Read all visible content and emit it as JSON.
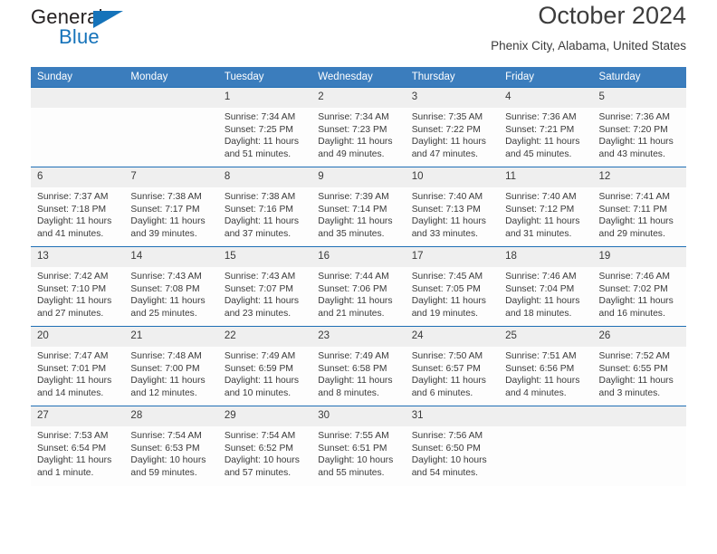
{
  "logo": {
    "word_top": "General",
    "word_bottom": "Blue",
    "triangle_color": "#1573ba",
    "text_color": "#231f20"
  },
  "header": {
    "title": "October 2024",
    "subtitle": "Phenix City, Alabama, United States"
  },
  "theme": {
    "header_row_bg": "#3b7dbd",
    "week_divider": "#1f6fb5",
    "daynum_bg": "#efefef",
    "cell_bg": "#fdfdfd"
  },
  "labels": {
    "sunrise_prefix": "Sunrise:",
    "sunset_prefix": "Sunset:",
    "daylight_prefix": "Daylight:"
  },
  "day_headers": [
    "Sunday",
    "Monday",
    "Tuesday",
    "Wednesday",
    "Thursday",
    "Friday",
    "Saturday"
  ],
  "weeks": [
    [
      {
        "day": "",
        "sunrise": "",
        "sunset": "",
        "daylight_line1": "",
        "daylight_line2": ""
      },
      {
        "day": "",
        "sunrise": "",
        "sunset": "",
        "daylight_line1": "",
        "daylight_line2": ""
      },
      {
        "day": "1",
        "sunrise": "Sunrise: 7:34 AM",
        "sunset": "Sunset: 7:25 PM",
        "daylight_line1": "Daylight: 11 hours",
        "daylight_line2": "and 51 minutes."
      },
      {
        "day": "2",
        "sunrise": "Sunrise: 7:34 AM",
        "sunset": "Sunset: 7:23 PM",
        "daylight_line1": "Daylight: 11 hours",
        "daylight_line2": "and 49 minutes."
      },
      {
        "day": "3",
        "sunrise": "Sunrise: 7:35 AM",
        "sunset": "Sunset: 7:22 PM",
        "daylight_line1": "Daylight: 11 hours",
        "daylight_line2": "and 47 minutes."
      },
      {
        "day": "4",
        "sunrise": "Sunrise: 7:36 AM",
        "sunset": "Sunset: 7:21 PM",
        "daylight_line1": "Daylight: 11 hours",
        "daylight_line2": "and 45 minutes."
      },
      {
        "day": "5",
        "sunrise": "Sunrise: 7:36 AM",
        "sunset": "Sunset: 7:20 PM",
        "daylight_line1": "Daylight: 11 hours",
        "daylight_line2": "and 43 minutes."
      }
    ],
    [
      {
        "day": "6",
        "sunrise": "Sunrise: 7:37 AM",
        "sunset": "Sunset: 7:18 PM",
        "daylight_line1": "Daylight: 11 hours",
        "daylight_line2": "and 41 minutes."
      },
      {
        "day": "7",
        "sunrise": "Sunrise: 7:38 AM",
        "sunset": "Sunset: 7:17 PM",
        "daylight_line1": "Daylight: 11 hours",
        "daylight_line2": "and 39 minutes."
      },
      {
        "day": "8",
        "sunrise": "Sunrise: 7:38 AM",
        "sunset": "Sunset: 7:16 PM",
        "daylight_line1": "Daylight: 11 hours",
        "daylight_line2": "and 37 minutes."
      },
      {
        "day": "9",
        "sunrise": "Sunrise: 7:39 AM",
        "sunset": "Sunset: 7:14 PM",
        "daylight_line1": "Daylight: 11 hours",
        "daylight_line2": "and 35 minutes."
      },
      {
        "day": "10",
        "sunrise": "Sunrise: 7:40 AM",
        "sunset": "Sunset: 7:13 PM",
        "daylight_line1": "Daylight: 11 hours",
        "daylight_line2": "and 33 minutes."
      },
      {
        "day": "11",
        "sunrise": "Sunrise: 7:40 AM",
        "sunset": "Sunset: 7:12 PM",
        "daylight_line1": "Daylight: 11 hours",
        "daylight_line2": "and 31 minutes."
      },
      {
        "day": "12",
        "sunrise": "Sunrise: 7:41 AM",
        "sunset": "Sunset: 7:11 PM",
        "daylight_line1": "Daylight: 11 hours",
        "daylight_line2": "and 29 minutes."
      }
    ],
    [
      {
        "day": "13",
        "sunrise": "Sunrise: 7:42 AM",
        "sunset": "Sunset: 7:10 PM",
        "daylight_line1": "Daylight: 11 hours",
        "daylight_line2": "and 27 minutes."
      },
      {
        "day": "14",
        "sunrise": "Sunrise: 7:43 AM",
        "sunset": "Sunset: 7:08 PM",
        "daylight_line1": "Daylight: 11 hours",
        "daylight_line2": "and 25 minutes."
      },
      {
        "day": "15",
        "sunrise": "Sunrise: 7:43 AM",
        "sunset": "Sunset: 7:07 PM",
        "daylight_line1": "Daylight: 11 hours",
        "daylight_line2": "and 23 minutes."
      },
      {
        "day": "16",
        "sunrise": "Sunrise: 7:44 AM",
        "sunset": "Sunset: 7:06 PM",
        "daylight_line1": "Daylight: 11 hours",
        "daylight_line2": "and 21 minutes."
      },
      {
        "day": "17",
        "sunrise": "Sunrise: 7:45 AM",
        "sunset": "Sunset: 7:05 PM",
        "daylight_line1": "Daylight: 11 hours",
        "daylight_line2": "and 19 minutes."
      },
      {
        "day": "18",
        "sunrise": "Sunrise: 7:46 AM",
        "sunset": "Sunset: 7:04 PM",
        "daylight_line1": "Daylight: 11 hours",
        "daylight_line2": "and 18 minutes."
      },
      {
        "day": "19",
        "sunrise": "Sunrise: 7:46 AM",
        "sunset": "Sunset: 7:02 PM",
        "daylight_line1": "Daylight: 11 hours",
        "daylight_line2": "and 16 minutes."
      }
    ],
    [
      {
        "day": "20",
        "sunrise": "Sunrise: 7:47 AM",
        "sunset": "Sunset: 7:01 PM",
        "daylight_line1": "Daylight: 11 hours",
        "daylight_line2": "and 14 minutes."
      },
      {
        "day": "21",
        "sunrise": "Sunrise: 7:48 AM",
        "sunset": "Sunset: 7:00 PM",
        "daylight_line1": "Daylight: 11 hours",
        "daylight_line2": "and 12 minutes."
      },
      {
        "day": "22",
        "sunrise": "Sunrise: 7:49 AM",
        "sunset": "Sunset: 6:59 PM",
        "daylight_line1": "Daylight: 11 hours",
        "daylight_line2": "and 10 minutes."
      },
      {
        "day": "23",
        "sunrise": "Sunrise: 7:49 AM",
        "sunset": "Sunset: 6:58 PM",
        "daylight_line1": "Daylight: 11 hours",
        "daylight_line2": "and 8 minutes."
      },
      {
        "day": "24",
        "sunrise": "Sunrise: 7:50 AM",
        "sunset": "Sunset: 6:57 PM",
        "daylight_line1": "Daylight: 11 hours",
        "daylight_line2": "and 6 minutes."
      },
      {
        "day": "25",
        "sunrise": "Sunrise: 7:51 AM",
        "sunset": "Sunset: 6:56 PM",
        "daylight_line1": "Daylight: 11 hours",
        "daylight_line2": "and 4 minutes."
      },
      {
        "day": "26",
        "sunrise": "Sunrise: 7:52 AM",
        "sunset": "Sunset: 6:55 PM",
        "daylight_line1": "Daylight: 11 hours",
        "daylight_line2": "and 3 minutes."
      }
    ],
    [
      {
        "day": "27",
        "sunrise": "Sunrise: 7:53 AM",
        "sunset": "Sunset: 6:54 PM",
        "daylight_line1": "Daylight: 11 hours",
        "daylight_line2": "and 1 minute."
      },
      {
        "day": "28",
        "sunrise": "Sunrise: 7:54 AM",
        "sunset": "Sunset: 6:53 PM",
        "daylight_line1": "Daylight: 10 hours",
        "daylight_line2": "and 59 minutes."
      },
      {
        "day": "29",
        "sunrise": "Sunrise: 7:54 AM",
        "sunset": "Sunset: 6:52 PM",
        "daylight_line1": "Daylight: 10 hours",
        "daylight_line2": "and 57 minutes."
      },
      {
        "day": "30",
        "sunrise": "Sunrise: 7:55 AM",
        "sunset": "Sunset: 6:51 PM",
        "daylight_line1": "Daylight: 10 hours",
        "daylight_line2": "and 55 minutes."
      },
      {
        "day": "31",
        "sunrise": "Sunrise: 7:56 AM",
        "sunset": "Sunset: 6:50 PM",
        "daylight_line1": "Daylight: 10 hours",
        "daylight_line2": "and 54 minutes."
      },
      {
        "day": "",
        "sunrise": "",
        "sunset": "",
        "daylight_line1": "",
        "daylight_line2": ""
      },
      {
        "day": "",
        "sunrise": "",
        "sunset": "",
        "daylight_line1": "",
        "daylight_line2": ""
      }
    ]
  ]
}
